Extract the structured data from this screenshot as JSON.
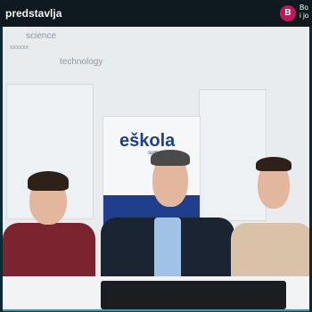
{
  "window": {
    "title": "predstavlja",
    "participant": {
      "avatar_initial": "B",
      "name_line1": "Bo",
      "name_line2": "i jo"
    }
  },
  "scene": {
    "wall_labels": [
      "science",
      "technology",
      "xxxxxx"
    ],
    "banner": {
      "logo": "eškola",
      "subtitle": "sum"
    },
    "accent_color": "#1aa5c8",
    "brand_color": "#1f3f8c"
  }
}
